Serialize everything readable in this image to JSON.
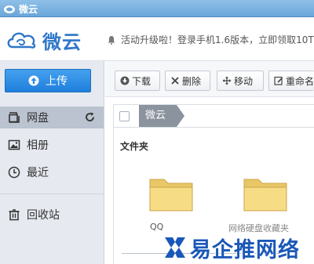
{
  "window": {
    "title": "微云"
  },
  "header": {
    "logo_text": "微云",
    "notice": "活动升级啦！登录手机1.6版本，立即领取10T"
  },
  "sidebar": {
    "upload_label": "上传",
    "items": [
      {
        "label": "网盘",
        "icon": "cloud-drive-icon",
        "active": true
      },
      {
        "label": "相册",
        "icon": "photo-icon",
        "active": false
      },
      {
        "label": "最近",
        "icon": "clock-icon",
        "active": false
      },
      {
        "label": "回收站",
        "icon": "trash-icon",
        "active": false
      }
    ]
  },
  "toolbar": {
    "download_label": "下载",
    "delete_label": "删除",
    "move_label": "移动",
    "rename_label": "重命名"
  },
  "breadcrumb": {
    "current": "微云"
  },
  "content": {
    "section_title": "文件夹",
    "folders": [
      {
        "name": "QQ"
      },
      {
        "name": "网络硬盘收藏夹"
      }
    ]
  },
  "watermark": {
    "text": "易企推网络"
  },
  "colors": {
    "accent": "#2f77c9",
    "upload_button": "#2a8be6",
    "sidebar_bg": "#e6e9ef",
    "active_item": "#bac3cf",
    "folder": "#f5d97a"
  }
}
